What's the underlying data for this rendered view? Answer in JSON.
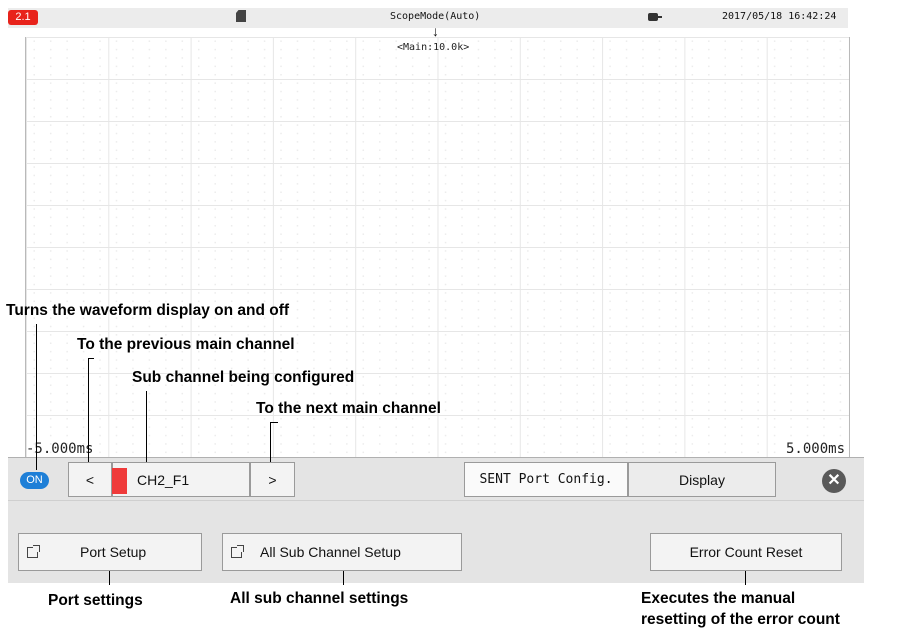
{
  "status_bar": {
    "channel_badge": "2.1",
    "mode": "ScopeMode(Auto)",
    "datetime": "2017/05/18 16:42:24"
  },
  "waveform": {
    "main_label": "<Main:10.0k>",
    "time_left": "-5.000ms",
    "time_right": "5.000ms"
  },
  "panel": {
    "on_toggle": "ON",
    "prev_arrow": "<",
    "channel_name": "CH2_F1",
    "next_arrow": ">",
    "tabs": [
      "SENT Port Config.",
      "Display"
    ],
    "buttons": {
      "port_setup": "Port Setup",
      "all_sub_channel_setup": "All Sub Channel Setup",
      "error_count_reset": "Error Count Reset"
    }
  },
  "annotations": {
    "waveform_toggle": "Turns the waveform display on and off",
    "prev_channel": "To the previous main channel",
    "sub_channel": "Sub channel being configured",
    "next_channel": "To the next main channel",
    "port_settings": "Port settings",
    "all_sub_channel_settings": "All sub channel settings",
    "error_reset_line1": "Executes the manual",
    "error_reset_line2": "resetting of the error count"
  },
  "colors": {
    "badge_red": "#e8231b",
    "on_blue": "#1e7fd7",
    "channel_strip": "#ef3a3a"
  }
}
